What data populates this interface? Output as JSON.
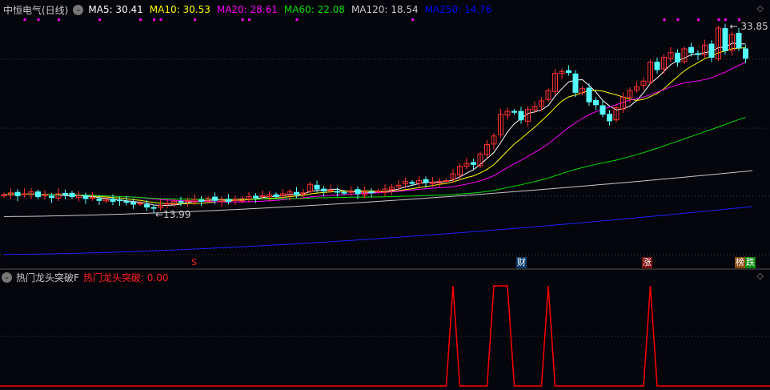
{
  "header": {
    "title": "中恒电气(日线)",
    "ma": [
      {
        "label": "MA5: 30.41",
        "color": "#ffffff"
      },
      {
        "label": "MA10: 30.53",
        "color": "#ffff00"
      },
      {
        "label": "MA20: 28.61",
        "color": "#ff00ff"
      },
      {
        "label": "MA60: 22.08",
        "color": "#00e000"
      },
      {
        "label": "MA120: 18.54",
        "color": "#c8c8c8"
      },
      {
        "label": "MA250: 14.76",
        "color": "#0000ff"
      }
    ]
  },
  "sub": {
    "title": "热门龙头突破F",
    "value_label": "热门龙头突破: 0.00"
  },
  "markers": {
    "s": "S",
    "cai": "财",
    "zhang": "涨",
    "bang": "榜",
    "die": "跌"
  },
  "annotations": {
    "high": "33.85",
    "low": "13.99"
  },
  "colors": {
    "up": "#ff3232",
    "down": "#54fcfc",
    "signal": "#ff0000",
    "dots": "#ff00ff"
  },
  "chart_data": {
    "type": "candlestick",
    "title": "中恒电气(日线)",
    "ylim": [
      9,
      35
    ],
    "closes": [
      16.0,
      16.2,
      15.9,
      16.1,
      16.3,
      15.8,
      16.0,
      15.7,
      16.1,
      16.0,
      15.8,
      15.9,
      15.6,
      15.7,
      15.4,
      15.5,
      15.3,
      15.4,
      15.2,
      15.0,
      15.1,
      14.7,
      14.6,
      14.9,
      15.1,
      15.3,
      15.2,
      15.4,
      15.5,
      15.3,
      15.6,
      15.4,
      15.5,
      15.3,
      15.5,
      15.6,
      15.8,
      15.7,
      15.9,
      16.0,
      15.8,
      16.1,
      16.3,
      16.0,
      16.2,
      17.1,
      16.6,
      16.4,
      16.5,
      16.3,
      16.2,
      16.4,
      16.1,
      16.3,
      16.2,
      16.4,
      16.6,
      16.8,
      17.0,
      17.4,
      17.2,
      17.5,
      17.3,
      17.3,
      17.4,
      17.5,
      18.2,
      19.0,
      19.3,
      19.2,
      20.3,
      21.3,
      22.2,
      24.5,
      24.8,
      24.7,
      23.9,
      25.0,
      25.3,
      25.9,
      27.0,
      28.8,
      29.0,
      28.9,
      26.8,
      27.2,
      25.8,
      25.5,
      24.5,
      23.8,
      25.2,
      26.3,
      27.0,
      27.4,
      28.0,
      30.0,
      29.2,
      30.5,
      31.0,
      30.0,
      31.4,
      31.0,
      30.8,
      31.8,
      30.5,
      33.6,
      31.2,
      32.9,
      31.5,
      30.4
    ],
    "ma120_range": [
      13.7,
      18.54
    ],
    "ma250_range": [
      9.7,
      14.76
    ],
    "signal_bars": [
      66,
      72,
      73,
      74,
      80,
      95
    ],
    "signal_ylim": [
      0,
      1
    ],
    "dot_bars": [
      3,
      5,
      8,
      14,
      20,
      22,
      23,
      28,
      35,
      36,
      43,
      60,
      97,
      99,
      102,
      105,
      106,
      108
    ]
  }
}
